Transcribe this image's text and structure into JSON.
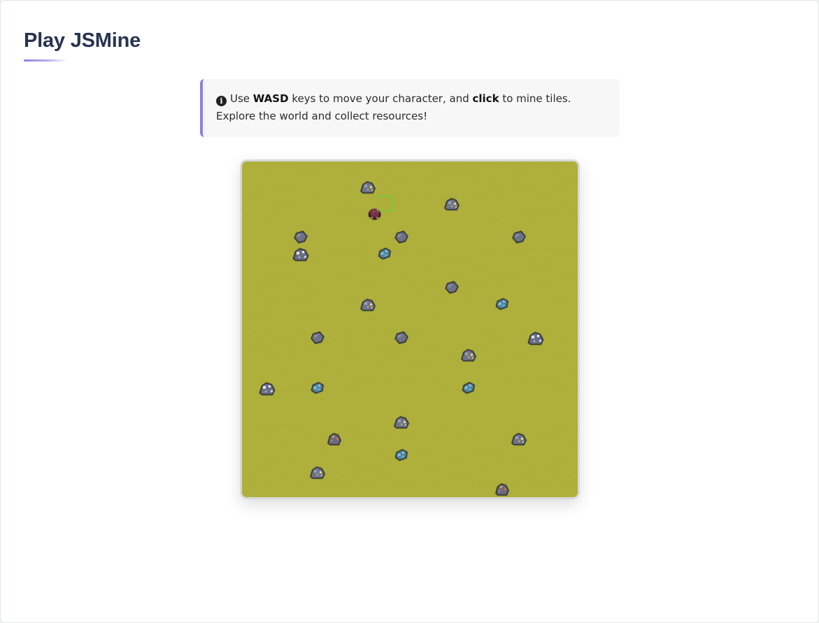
{
  "page": {
    "title": "Play JSMine"
  },
  "instructions": {
    "icon": "info-circle-icon",
    "prefix": "Use ",
    "keys": "WASD",
    "middle": " keys to move your character, and ",
    "action": "click",
    "suffix": " to mine tiles. Explore the world and collect resources!"
  },
  "game": {
    "ground_color": "#aeb03b",
    "highlight_color": "#4ddc3b",
    "tiles": [
      {
        "type": "gold-ore",
        "col": 7,
        "row": 1
      },
      {
        "type": "gold-ore",
        "col": 12,
        "row": 2
      },
      {
        "type": "rock",
        "col": 3,
        "row": 4
      },
      {
        "type": "rock",
        "col": 9,
        "row": 4
      },
      {
        "type": "rock",
        "col": 16,
        "row": 4
      },
      {
        "type": "silver-ore",
        "col": 3,
        "row": 5
      },
      {
        "type": "diamond-ore",
        "col": 8,
        "row": 5
      },
      {
        "type": "rock",
        "col": 12,
        "row": 7
      },
      {
        "type": "gold-ore",
        "col": 7,
        "row": 8
      },
      {
        "type": "diamond-ore",
        "col": 15,
        "row": 8
      },
      {
        "type": "rock",
        "col": 4,
        "row": 10
      },
      {
        "type": "rock",
        "col": 9,
        "row": 10
      },
      {
        "type": "silver-ore",
        "col": 17,
        "row": 10
      },
      {
        "type": "gold-ore",
        "col": 13,
        "row": 11
      },
      {
        "type": "silver-ore",
        "col": 1,
        "row": 13
      },
      {
        "type": "diamond-ore",
        "col": 4,
        "row": 13
      },
      {
        "type": "diamond-ore",
        "col": 13,
        "row": 13
      },
      {
        "type": "gold-ore",
        "col": 9,
        "row": 15
      },
      {
        "type": "copper-ore",
        "col": 5,
        "row": 16
      },
      {
        "type": "gold-ore",
        "col": 16,
        "row": 16
      },
      {
        "type": "diamond-ore",
        "col": 9,
        "row": 17
      },
      {
        "type": "gold-ore",
        "col": 4,
        "row": 18
      },
      {
        "type": "copper-ore",
        "col": 15,
        "row": 19
      }
    ],
    "player": {
      "col": 7.4,
      "row": 2.6
    },
    "cursor": {
      "col": 8,
      "row": 2
    }
  }
}
